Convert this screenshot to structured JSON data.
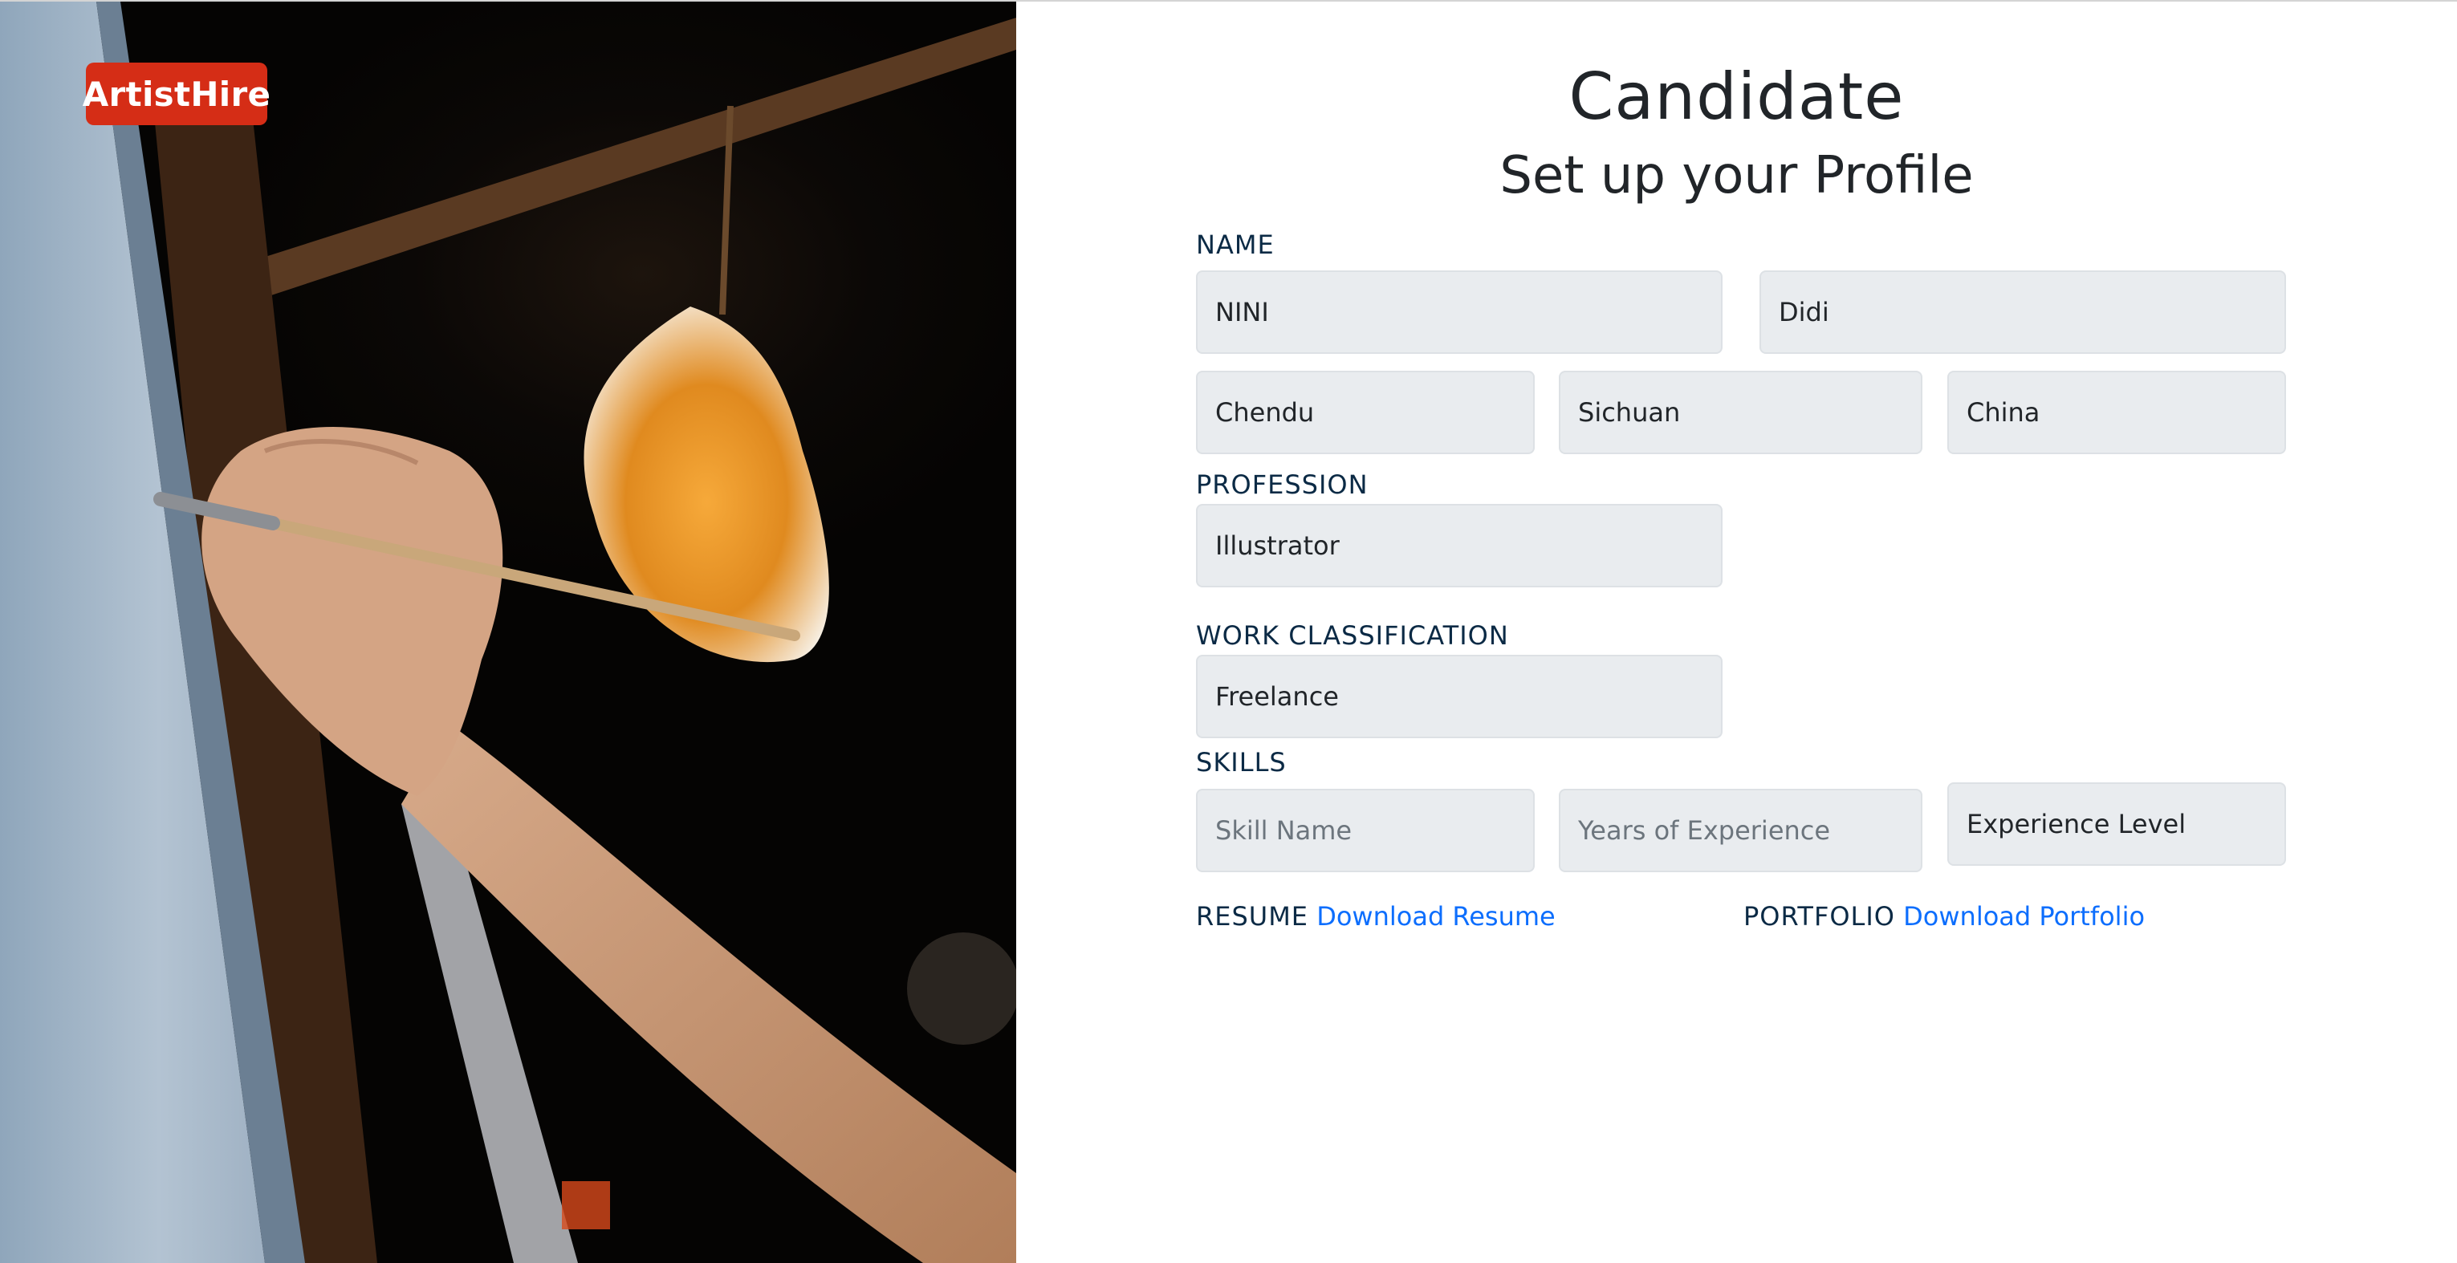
{
  "brand": {
    "logo_text": "ArtistHire",
    "logo_color": "#d52d16"
  },
  "header": {
    "title": "Candidate",
    "subtitle": "Set up your Profile"
  },
  "form": {
    "name_label": "NAME",
    "first_name": "NINI",
    "last_name": "Didi",
    "city": "Chendu",
    "province": "Sichuan",
    "country": "China",
    "profession_label": "PROFESSION",
    "profession": "Illustrator",
    "work_classification_label": "WORK CLASSIFICATION",
    "work_classification": "Freelance",
    "skills_label": "SKILLS",
    "skill_name_placeholder": "Skill Name",
    "years_experience_placeholder": "Years of Experience",
    "experience_level": "Experience Level",
    "resume_label": "RESUME",
    "resume_link": "Download Resume",
    "portfolio_label": "PORTFOLIO",
    "portfolio_link": "Download Portfolio"
  },
  "colors": {
    "field_bg": "#e9ecef",
    "link": "#0d6efd",
    "label": "#0b2a45"
  }
}
